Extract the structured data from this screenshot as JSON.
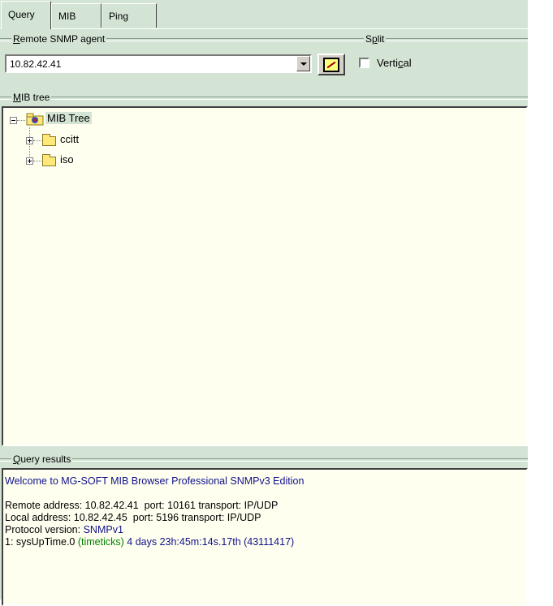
{
  "tabs": [
    "Query",
    "MIB",
    "Ping"
  ],
  "remote_agent": {
    "label_prefix": "R",
    "label_rest": "emote SNMP agent",
    "address": "10.82.42.41"
  },
  "split": {
    "label_prefix": "S",
    "label_mid": "p",
    "label_rest": "lit",
    "checkbox_label_a": "Verti",
    "checkbox_label_u": "c",
    "checkbox_label_b": "al",
    "checked": false
  },
  "mib_tree": {
    "label_u": "M",
    "label_rest": "IB tree",
    "root": "MIB Tree",
    "children": [
      "ccitt",
      "iso"
    ]
  },
  "query_results": {
    "label_u": "Q",
    "label_rest": "uery results",
    "welcome": "Welcome to MG-SOFT MIB Browser Professional SNMPv3 Edition",
    "remote_line": "Remote address: 10.82.42.41  port: 10161 transport: IP/UDP",
    "local_line": "Local address: 10.82.42.45  port: 5196 transport: IP/UDP",
    "protocol_label": "Protocol version: ",
    "protocol_value": "SNMPv1",
    "result_prefix": "1: sysUpTime.0 ",
    "result_type": "(timeticks)",
    "result_value": " 4 days 23h:45m:14s.17th (43111417)"
  },
  "colors": {
    "panel_bg": "#d4e4d4",
    "text_bg": "#fffff0",
    "blue_text": "#10108a",
    "green_text": "#008000"
  }
}
